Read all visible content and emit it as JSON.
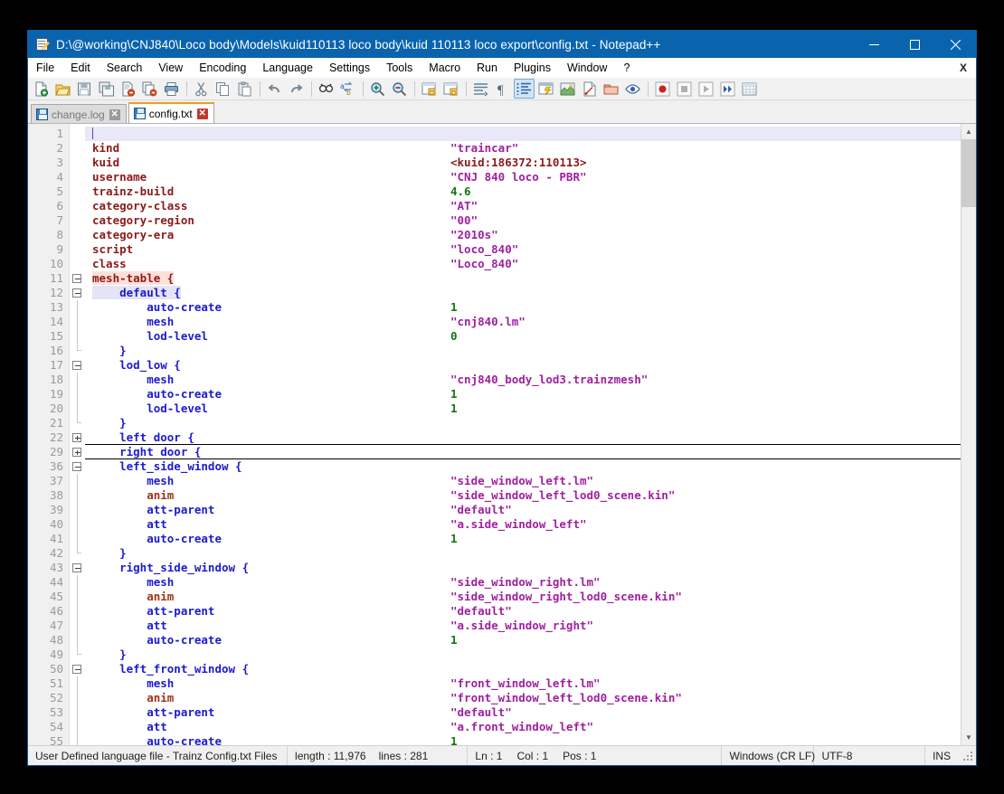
{
  "window": {
    "title": "D:\\@working\\CNJ840\\Loco body\\Models\\kuid110113 loco body\\kuid 110113 loco export\\config.txt - Notepad++",
    "app_icon": "notepad-plus-plus-icon",
    "minimize_label": "–",
    "maximize_label": "□",
    "close_label": "✕",
    "titlebar_color": "#0a64ad"
  },
  "menu": {
    "items": [
      "File",
      "Edit",
      "Search",
      "View",
      "Encoding",
      "Language",
      "Settings",
      "Tools",
      "Macro",
      "Run",
      "Plugins",
      "Window",
      "?"
    ],
    "close_document_label": "X"
  },
  "toolbar": {
    "buttons": [
      {
        "name": "new-file-icon",
        "title": "New"
      },
      {
        "name": "open-file-icon",
        "title": "Open"
      },
      {
        "name": "save-icon",
        "title": "Save"
      },
      {
        "name": "save-all-icon",
        "title": "Save All"
      },
      {
        "name": "close-document-icon",
        "title": "Close"
      },
      {
        "name": "close-all-documents-icon",
        "title": "Close All"
      },
      {
        "name": "print-icon",
        "title": "Print"
      },
      {
        "name": "separator",
        "title": ""
      },
      {
        "name": "cut-icon",
        "title": "Cut"
      },
      {
        "name": "copy-icon",
        "title": "Copy"
      },
      {
        "name": "paste-icon",
        "title": "Paste"
      },
      {
        "name": "separator",
        "title": ""
      },
      {
        "name": "undo-icon",
        "title": "Undo"
      },
      {
        "name": "redo-icon",
        "title": "Redo"
      },
      {
        "name": "separator",
        "title": ""
      },
      {
        "name": "find-icon",
        "title": "Find"
      },
      {
        "name": "replace-icon",
        "title": "Replace"
      },
      {
        "name": "separator",
        "title": ""
      },
      {
        "name": "zoom-in-icon",
        "title": "Zoom In"
      },
      {
        "name": "zoom-out-icon",
        "title": "Zoom Out"
      },
      {
        "name": "separator",
        "title": ""
      },
      {
        "name": "sync-vertical-scroll-icon",
        "title": "Synchronize Vertical Scrolling"
      },
      {
        "name": "sync-horizontal-scroll-icon",
        "title": "Synchronize Horizontal Scrolling"
      },
      {
        "name": "separator",
        "title": ""
      },
      {
        "name": "word-wrap-icon",
        "title": "Word wrap"
      },
      {
        "name": "show-all-characters-icon",
        "title": "Show All Characters"
      },
      {
        "name": "show-indent-guide-icon",
        "title": "Show Indent Guide"
      },
      {
        "name": "user-defined-dialog-icon",
        "title": "User Defined Dialogue"
      },
      {
        "name": "document-map-icon",
        "title": "Document Map"
      },
      {
        "name": "function-list-icon",
        "title": "Function List"
      },
      {
        "name": "folder-as-workspace-icon",
        "title": "Folder as Workspace"
      },
      {
        "name": "monitoring-icon",
        "title": "Monitoring"
      },
      {
        "name": "separator",
        "title": ""
      },
      {
        "name": "record-macro-icon",
        "title": "Start Recording"
      },
      {
        "name": "stop-macro-icon",
        "title": "Stop Recording"
      },
      {
        "name": "play-macro-icon",
        "title": "Playback"
      },
      {
        "name": "run-macro-multiple-icon",
        "title": "Run a Macro Multiple Times"
      },
      {
        "name": "save-macro-icon",
        "title": "Save Current Recorded Macro"
      }
    ]
  },
  "tabs": [
    {
      "label": "change.log",
      "active": false,
      "close_label": "✕"
    },
    {
      "label": "config.txt",
      "active": true,
      "close_label": "✕"
    }
  ],
  "editor": {
    "caret_line": 1,
    "lines": [
      {
        "n": 1,
        "fold": "none",
        "indent": 0,
        "key": "",
        "keyclass": "",
        "value": "",
        "valclass": "",
        "caret": true,
        "current": true
      },
      {
        "n": 2,
        "fold": "none",
        "indent": 0,
        "key": "kind",
        "keyclass": "k-key",
        "value": "\"traincar\"",
        "valclass": "k-str"
      },
      {
        "n": 3,
        "fold": "none",
        "indent": 0,
        "key": "kuid",
        "keyclass": "k-key",
        "value": "<kuid:186372:110113>",
        "valclass": "k-kuid"
      },
      {
        "n": 4,
        "fold": "none",
        "indent": 0,
        "key": "username",
        "keyclass": "k-key",
        "value": "\"CNJ 840 loco - PBR\"",
        "valclass": "k-str"
      },
      {
        "n": 5,
        "fold": "none",
        "indent": 0,
        "key": "trainz-build",
        "keyclass": "k-key",
        "value": "4.6",
        "valclass": "k-num"
      },
      {
        "n": 6,
        "fold": "none",
        "indent": 0,
        "key": "category-class",
        "keyclass": "k-key",
        "value": "\"AT\"",
        "valclass": "k-str"
      },
      {
        "n": 7,
        "fold": "none",
        "indent": 0,
        "key": "category-region",
        "keyclass": "k-key",
        "value": "\"00\"",
        "valclass": "k-str"
      },
      {
        "n": 8,
        "fold": "none",
        "indent": 0,
        "key": "category-era",
        "keyclass": "k-key",
        "value": "\"2010s\"",
        "valclass": "k-str"
      },
      {
        "n": 9,
        "fold": "none",
        "indent": 0,
        "key": "script",
        "keyclass": "k-key",
        "value": "\"loco_840\"",
        "valclass": "k-str"
      },
      {
        "n": 10,
        "fold": "none",
        "indent": 0,
        "key": "class",
        "keyclass": "k-key",
        "value": "\"Loco_840\"",
        "valclass": "k-str"
      },
      {
        "n": 11,
        "fold": "minus",
        "indent": 0,
        "key": "mesh-table {",
        "keyclass": "k-key hl-brace",
        "value": "",
        "valclass": ""
      },
      {
        "n": 12,
        "fold": "minus",
        "indent": 1,
        "key": "default {",
        "keyclass": "k-blue hl-sel",
        "value": "",
        "valclass": ""
      },
      {
        "n": 13,
        "fold": "bar",
        "indent": 2,
        "key": "auto-create",
        "keyclass": "k-blue",
        "value": "1",
        "valclass": "k-num"
      },
      {
        "n": 14,
        "fold": "bar",
        "indent": 2,
        "key": "mesh",
        "keyclass": "k-blue",
        "value": "\"cnj840.lm\"",
        "valclass": "k-str"
      },
      {
        "n": 15,
        "fold": "bar",
        "indent": 2,
        "key": "lod-level",
        "keyclass": "k-blue",
        "value": "0",
        "valclass": "k-num"
      },
      {
        "n": 16,
        "fold": "tail",
        "indent": 1,
        "key": "}",
        "keyclass": "k-brace",
        "value": "",
        "valclass": ""
      },
      {
        "n": 17,
        "fold": "minus",
        "indent": 1,
        "key": "lod_low {",
        "keyclass": "k-blue",
        "value": "",
        "valclass": ""
      },
      {
        "n": 18,
        "fold": "bar",
        "indent": 2,
        "key": "mesh",
        "keyclass": "k-blue",
        "value": "\"cnj840_body_lod3.trainzmesh\"",
        "valclass": "k-str"
      },
      {
        "n": 19,
        "fold": "bar",
        "indent": 2,
        "key": "auto-create",
        "keyclass": "k-blue",
        "value": "1",
        "valclass": "k-num"
      },
      {
        "n": 20,
        "fold": "bar",
        "indent": 2,
        "key": "lod-level",
        "keyclass": "k-blue",
        "value": "1",
        "valclass": "k-num"
      },
      {
        "n": 21,
        "fold": "tail",
        "indent": 1,
        "key": "}",
        "keyclass": "k-brace",
        "value": "",
        "valclass": ""
      },
      {
        "n": 22,
        "fold": "plus",
        "indent": 1,
        "key": "left door {",
        "keyclass": "k-blue",
        "value": "",
        "valclass": "",
        "folded": true
      },
      {
        "n": 29,
        "fold": "plus",
        "indent": 1,
        "key": "right door {",
        "keyclass": "k-blue",
        "value": "",
        "valclass": "",
        "folded": true
      },
      {
        "n": 36,
        "fold": "minus",
        "indent": 1,
        "key": "left_side_window {",
        "keyclass": "k-blue",
        "value": "",
        "valclass": ""
      },
      {
        "n": 37,
        "fold": "bar",
        "indent": 2,
        "key": "mesh",
        "keyclass": "k-blue",
        "value": "\"side_window_left.lm\"",
        "valclass": "k-str"
      },
      {
        "n": 38,
        "fold": "bar",
        "indent": 2,
        "key": "anim",
        "keyclass": "k-anim",
        "value": "\"side_window_left_lod0_scene.kin\"",
        "valclass": "k-str"
      },
      {
        "n": 39,
        "fold": "bar",
        "indent": 2,
        "key": "att-parent",
        "keyclass": "k-blue",
        "value": "\"default\"",
        "valclass": "k-str"
      },
      {
        "n": 40,
        "fold": "bar",
        "indent": 2,
        "key": "att",
        "keyclass": "k-blue",
        "value": "\"a.side_window_left\"",
        "valclass": "k-str"
      },
      {
        "n": 41,
        "fold": "bar",
        "indent": 2,
        "key": "auto-create",
        "keyclass": "k-blue",
        "value": "1",
        "valclass": "k-num"
      },
      {
        "n": 42,
        "fold": "tail",
        "indent": 1,
        "key": "}",
        "keyclass": "k-brace",
        "value": "",
        "valclass": ""
      },
      {
        "n": 43,
        "fold": "minus",
        "indent": 1,
        "key": "right_side_window {",
        "keyclass": "k-blue",
        "value": "",
        "valclass": ""
      },
      {
        "n": 44,
        "fold": "bar",
        "indent": 2,
        "key": "mesh",
        "keyclass": "k-blue",
        "value": "\"side_window_right.lm\"",
        "valclass": "k-str"
      },
      {
        "n": 45,
        "fold": "bar",
        "indent": 2,
        "key": "anim",
        "keyclass": "k-anim",
        "value": "\"side_window_right_lod0_scene.kin\"",
        "valclass": "k-str"
      },
      {
        "n": 46,
        "fold": "bar",
        "indent": 2,
        "key": "att-parent",
        "keyclass": "k-blue",
        "value": "\"default\"",
        "valclass": "k-str"
      },
      {
        "n": 47,
        "fold": "bar",
        "indent": 2,
        "key": "att",
        "keyclass": "k-blue",
        "value": "\"a.side_window_right\"",
        "valclass": "k-str"
      },
      {
        "n": 48,
        "fold": "bar",
        "indent": 2,
        "key": "auto-create",
        "keyclass": "k-blue",
        "value": "1",
        "valclass": "k-num"
      },
      {
        "n": 49,
        "fold": "tail",
        "indent": 1,
        "key": "}",
        "keyclass": "k-brace",
        "value": "",
        "valclass": ""
      },
      {
        "n": 50,
        "fold": "minus",
        "indent": 1,
        "key": "left_front_window {",
        "keyclass": "k-blue",
        "value": "",
        "valclass": ""
      },
      {
        "n": 51,
        "fold": "bar",
        "indent": 2,
        "key": "mesh",
        "keyclass": "k-blue",
        "value": "\"front_window_left.lm\"",
        "valclass": "k-str"
      },
      {
        "n": 52,
        "fold": "bar",
        "indent": 2,
        "key": "anim",
        "keyclass": "k-anim",
        "value": "\"front_window_left_lod0_scene.kin\"",
        "valclass": "k-str"
      },
      {
        "n": 53,
        "fold": "bar",
        "indent": 2,
        "key": "att-parent",
        "keyclass": "k-blue",
        "value": "\"default\"",
        "valclass": "k-str"
      },
      {
        "n": 54,
        "fold": "bar",
        "indent": 2,
        "key": "att",
        "keyclass": "k-blue",
        "value": "\"a.front_window_left\"",
        "valclass": "k-str"
      },
      {
        "n": 55,
        "fold": "bar",
        "indent": 2,
        "key": "auto-create",
        "keyclass": "k-blue",
        "value": "1",
        "valclass": "k-num"
      }
    ]
  },
  "scrollbar": {
    "up_arrow": "▲",
    "down_arrow": "▼"
  },
  "statusbar": {
    "language": "User Defined language file - Trainz Config.txt Files",
    "length": "length : 11,976",
    "lines": "lines : 281",
    "ln": "Ln : 1",
    "col": "Col : 1",
    "pos": "Pos : 1",
    "eol": "Windows (CR LF)",
    "encoding": "UTF-8",
    "insert_mode": "INS"
  }
}
